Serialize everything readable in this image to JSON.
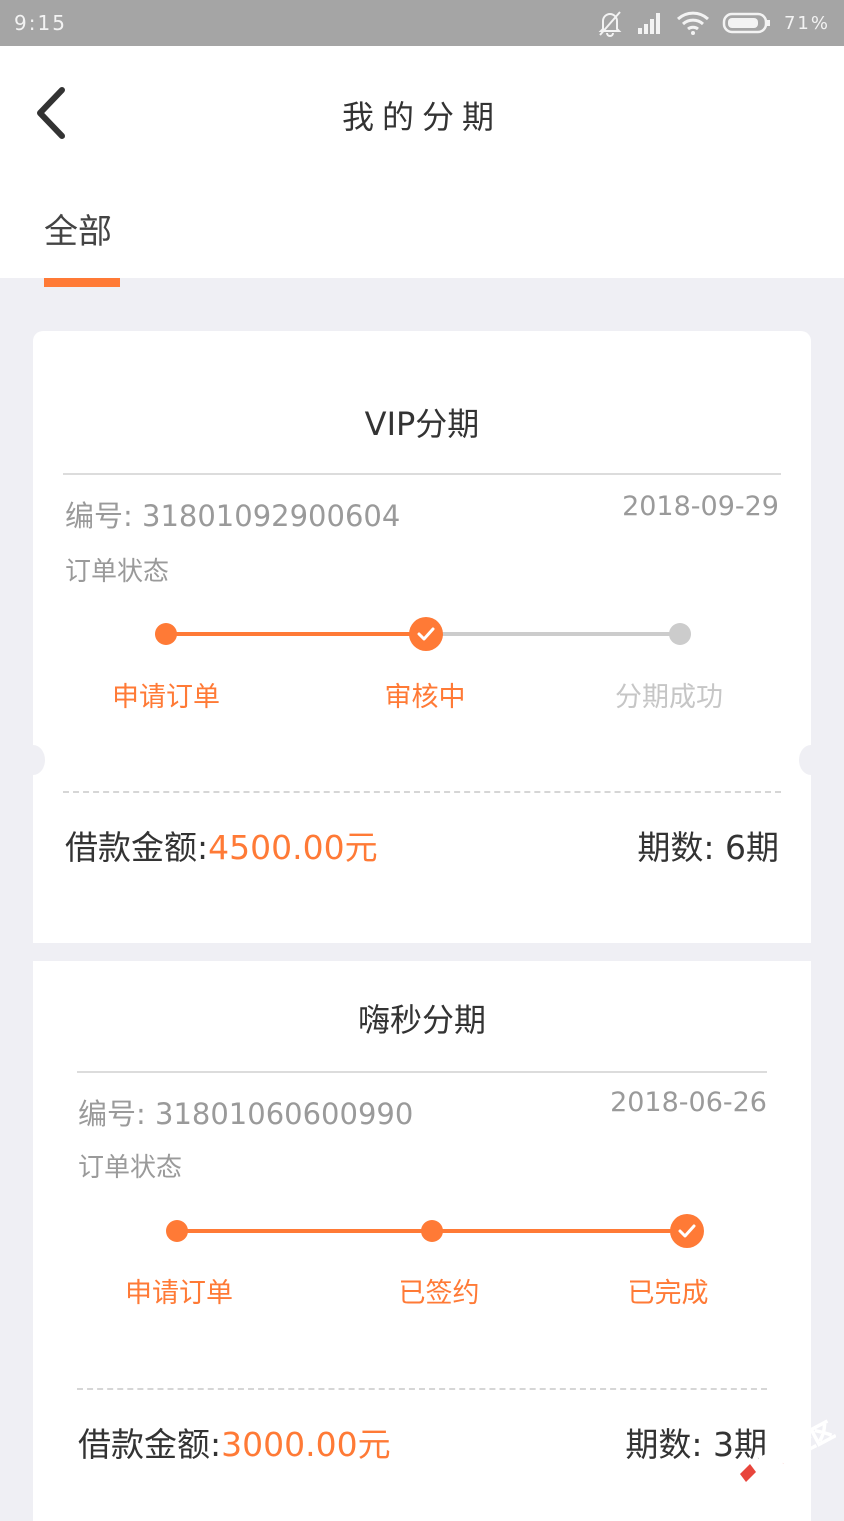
{
  "status_bar": {
    "time": "9:15",
    "battery": "71%"
  },
  "header": {
    "title": "我的分期"
  },
  "tabs": [
    {
      "label": "全部",
      "active": true
    }
  ],
  "orders": [
    {
      "product": "VIP分期",
      "order_no": "编号: 31801092900604",
      "date": "2018-09-29",
      "status_label": "订单状态",
      "steps": [
        "申请订单",
        "审核中",
        "分期成功"
      ],
      "amount_label": "借款金额:",
      "amount": "4500.00元",
      "periods": "期数: 6期"
    },
    {
      "product": "嗨秒分期",
      "order_no": "编号: 31801060600990",
      "date": "2018-06-26",
      "status_label": "订单状态",
      "steps": [
        "申请订单",
        "已签约",
        "已完成"
      ],
      "amount_label": "借款金额:",
      "amount": "3000.00元",
      "periods": "期数: 3期"
    }
  ],
  "watermark": "卡农社区",
  "colors": {
    "accent": "#ff7a36",
    "inactive": "#cccccc"
  }
}
